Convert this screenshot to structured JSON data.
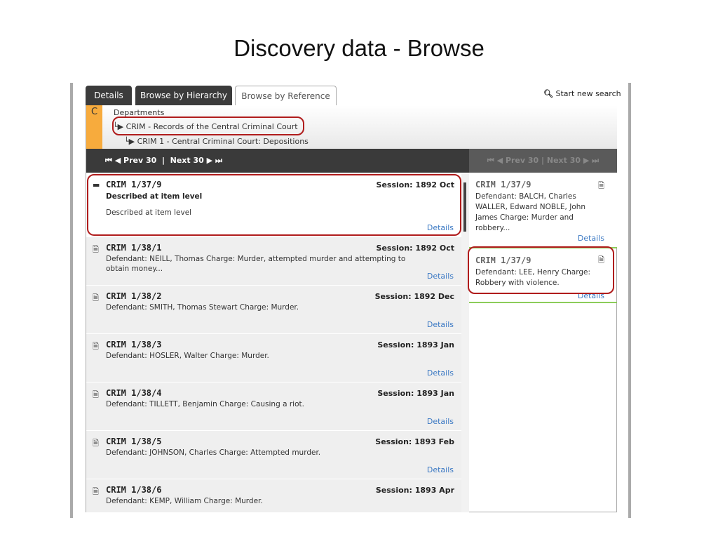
{
  "title": "Discovery data - Browse",
  "tabs": [
    "Details",
    "Browse by Hierarchy",
    "Browse by Reference"
  ],
  "search": "Start new search",
  "breadcrumb": {
    "letter": "C",
    "items": [
      "Departments",
      "CRIM - Records of the Central Criminal Court",
      "CRIM 1 - Central Criminal Court: Depositions"
    ]
  },
  "pager": {
    "prev": "Prev 30",
    "next": "Next 30"
  },
  "details_label": "Details",
  "items": [
    {
      "ref": "CRIM 1/37/9",
      "title": "Described at item level",
      "session": "Session: 1892 Oct",
      "desc": "Described at item level"
    },
    {
      "ref": "CRIM 1/38/1",
      "session": "Session: 1892 Oct",
      "desc": "Defendant: NEILL, Thomas Charge: Murder, attempted murder and attempting to obtain money..."
    },
    {
      "ref": "CRIM 1/38/2",
      "session": "Session: 1892 Dec",
      "desc": "Defendant: SMITH, Thomas Stewart Charge: Murder."
    },
    {
      "ref": "CRIM 1/38/3",
      "session": "Session: 1893 Jan",
      "desc": "Defendant: HOSLER, Walter Charge: Murder."
    },
    {
      "ref": "CRIM 1/38/4",
      "session": "Session: 1893 Jan",
      "desc": "Defendant: TILLETT, Benjamin Charge: Causing a riot."
    },
    {
      "ref": "CRIM 1/38/5",
      "session": "Session: 1893 Feb",
      "desc": "Defendant: JOHNSON, Charles Charge: Attempted murder."
    },
    {
      "ref": "CRIM 1/38/6",
      "session": "Session: 1893 Apr",
      "desc": "Defendant: KEMP, William Charge: Murder."
    }
  ],
  "right_items": [
    {
      "ref": "CRIM 1/37/9",
      "desc": "Defendant: BALCH, Charles WALLER, Edward NOBLE, John James Charge: Murder and robbery..."
    },
    {
      "ref": "CRIM 1/37/9",
      "desc": "Defendant: LEE, Henry Charge: Robbery with violence."
    }
  ],
  "colors": {
    "accent": "#f7ab3d",
    "highlight": "#b01c1c",
    "link": "#3a78c3"
  }
}
